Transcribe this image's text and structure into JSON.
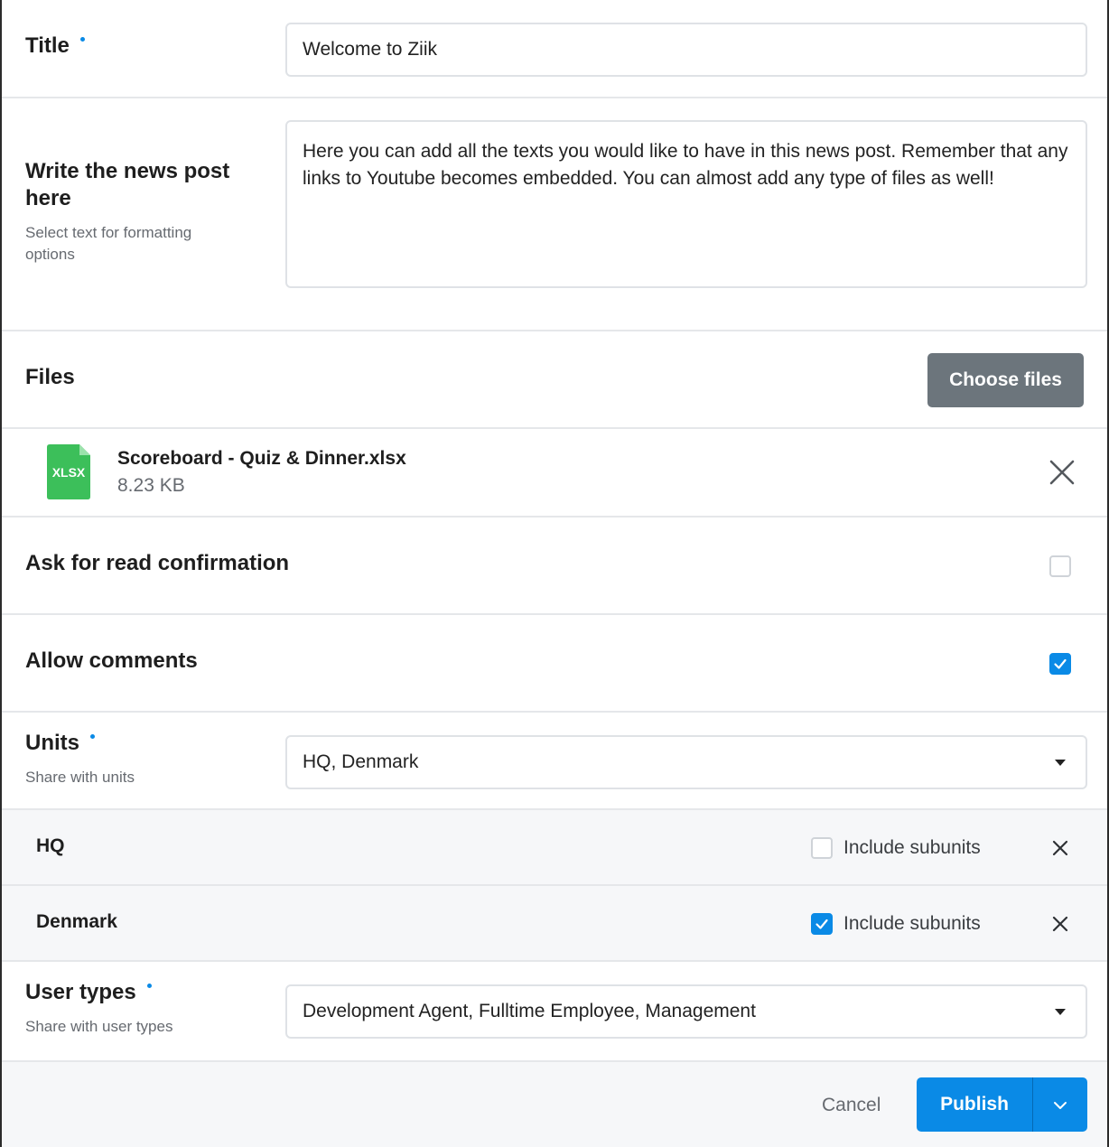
{
  "title_field": {
    "label": "Title",
    "value": "Welcome to Ziik"
  },
  "post_field": {
    "label_line1": "Write the news post",
    "label_line2": "here",
    "hint_line1": "Select text for formatting",
    "hint_line2": "options",
    "body": "Here you can add all the texts you would like to have in this news post. Remember that any links to Youtube becomes embedded. You can almost add any type of files as well!"
  },
  "files": {
    "label": "Files",
    "choose_label": "Choose files",
    "items": [
      {
        "icon_text": "XLSX",
        "name": "Scoreboard - Quiz & Dinner.xlsx",
        "size": "8.23 KB",
        "icon_color": "#3cbf5a"
      }
    ]
  },
  "read_confirmation": {
    "label": "Ask for read confirmation",
    "checked": false
  },
  "allow_comments": {
    "label": "Allow comments",
    "checked": true
  },
  "units": {
    "label": "Units",
    "hint": "Share with units",
    "selected": "HQ, Denmark",
    "items": [
      {
        "name": "HQ",
        "include_label": "Include subunits",
        "include_subunits": false
      },
      {
        "name": "Denmark",
        "include_label": "Include subunits",
        "include_subunits": true
      }
    ]
  },
  "user_types": {
    "label": "User types",
    "hint": "Share with user types",
    "selected": "Development Agent, Fulltime Employee, Management"
  },
  "footer": {
    "cancel_label": "Cancel",
    "publish_label": "Publish"
  },
  "colors": {
    "accent": "#0a8ae6",
    "button_gray": "#6c757c",
    "xlsx_green": "#3cbf5a"
  }
}
